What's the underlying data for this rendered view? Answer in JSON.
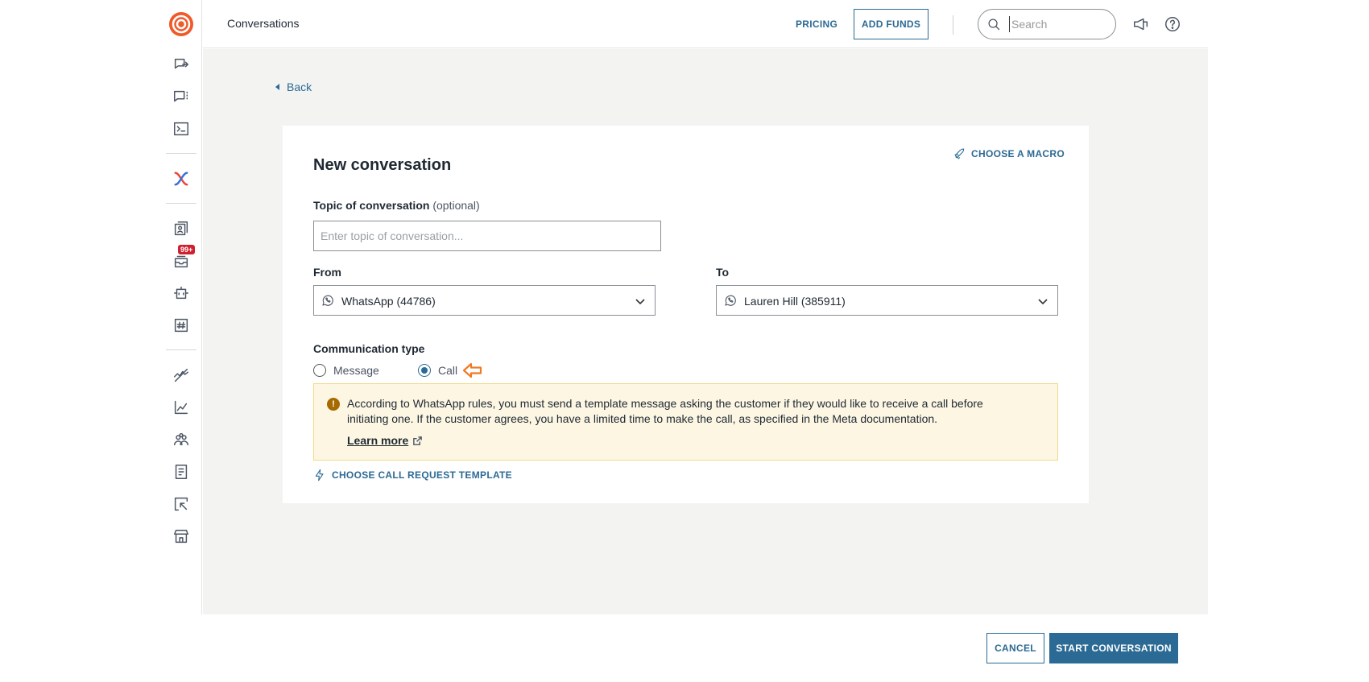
{
  "header": {
    "title": "Conversations",
    "pricing_label": "PRICING",
    "add_funds_label": "ADD FUNDS",
    "search_placeholder": "Search"
  },
  "sidebar": {
    "items": [
      {
        "name": "send-message-icon"
      },
      {
        "name": "chat-list-icon"
      },
      {
        "name": "terminal-icon"
      },
      {
        "name": "brand-x-icon"
      },
      {
        "name": "contacts-icon"
      },
      {
        "name": "inbox-icon",
        "badge": "99+"
      },
      {
        "name": "bot-icon"
      },
      {
        "name": "hashtag-icon"
      },
      {
        "name": "flows-icon"
      },
      {
        "name": "analytics-icon"
      },
      {
        "name": "people-icon"
      },
      {
        "name": "docs-icon"
      },
      {
        "name": "reports-icon"
      },
      {
        "name": "store-icon"
      }
    ]
  },
  "main": {
    "back_label": "Back",
    "card": {
      "title": "New conversation",
      "macro_label": "CHOOSE A MACRO",
      "topic": {
        "label": "Topic of conversation",
        "optional": "(optional)",
        "placeholder": "Enter topic of conversation...",
        "value": ""
      },
      "from": {
        "label": "From",
        "value": "WhatsApp (44786)"
      },
      "to": {
        "label": "To",
        "value": "Lauren Hill (385911)"
      },
      "comm_type": {
        "label": "Communication type",
        "options": [
          "Message",
          "Call"
        ],
        "selected": "Call"
      },
      "warning": {
        "text": "According to WhatsApp rules, you must send a template message asking the customer if they would like to receive a call before initiating one. If the customer agrees, you have a limited time to make the call, as specified in the Meta documentation.",
        "learn_more": "Learn more"
      },
      "template_label": "CHOOSE CALL REQUEST TEMPLATE"
    }
  },
  "footer": {
    "cancel_label": "CANCEL",
    "start_label": "START CONVERSATION"
  },
  "colors": {
    "accent": "#2b6a94",
    "brand": "#f0592a",
    "annotation_arrow": "#f07a24",
    "warning_bg": "#fdf6e3"
  }
}
